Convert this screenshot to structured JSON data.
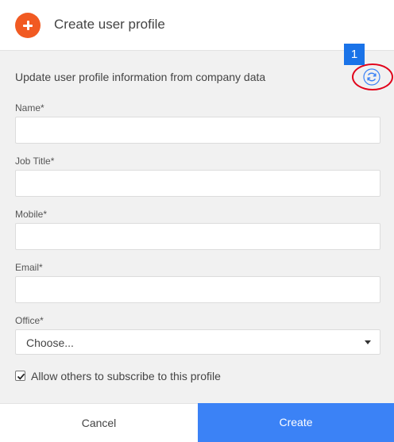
{
  "header": {
    "icon": "add-icon",
    "accent_color": "#f15a22",
    "title": "Create user profile"
  },
  "sync": {
    "text": "Update user profile information from company data",
    "icon": "refresh-icon",
    "highlight_color": "#e1001a",
    "badge": "1",
    "badge_color": "#1a73e8"
  },
  "form": {
    "fields": [
      {
        "label": "Name*",
        "value": ""
      },
      {
        "label": "Job Title*",
        "value": ""
      },
      {
        "label": "Mobile*",
        "value": ""
      },
      {
        "label": "Email*",
        "value": ""
      }
    ],
    "office": {
      "label": "Office*",
      "selected": "Choose..."
    },
    "subscribe": {
      "label": "Allow others to subscribe to this profile",
      "checked": true
    }
  },
  "footer": {
    "cancel_label": "Cancel",
    "create_label": "Create",
    "create_color": "#3b82f6"
  }
}
